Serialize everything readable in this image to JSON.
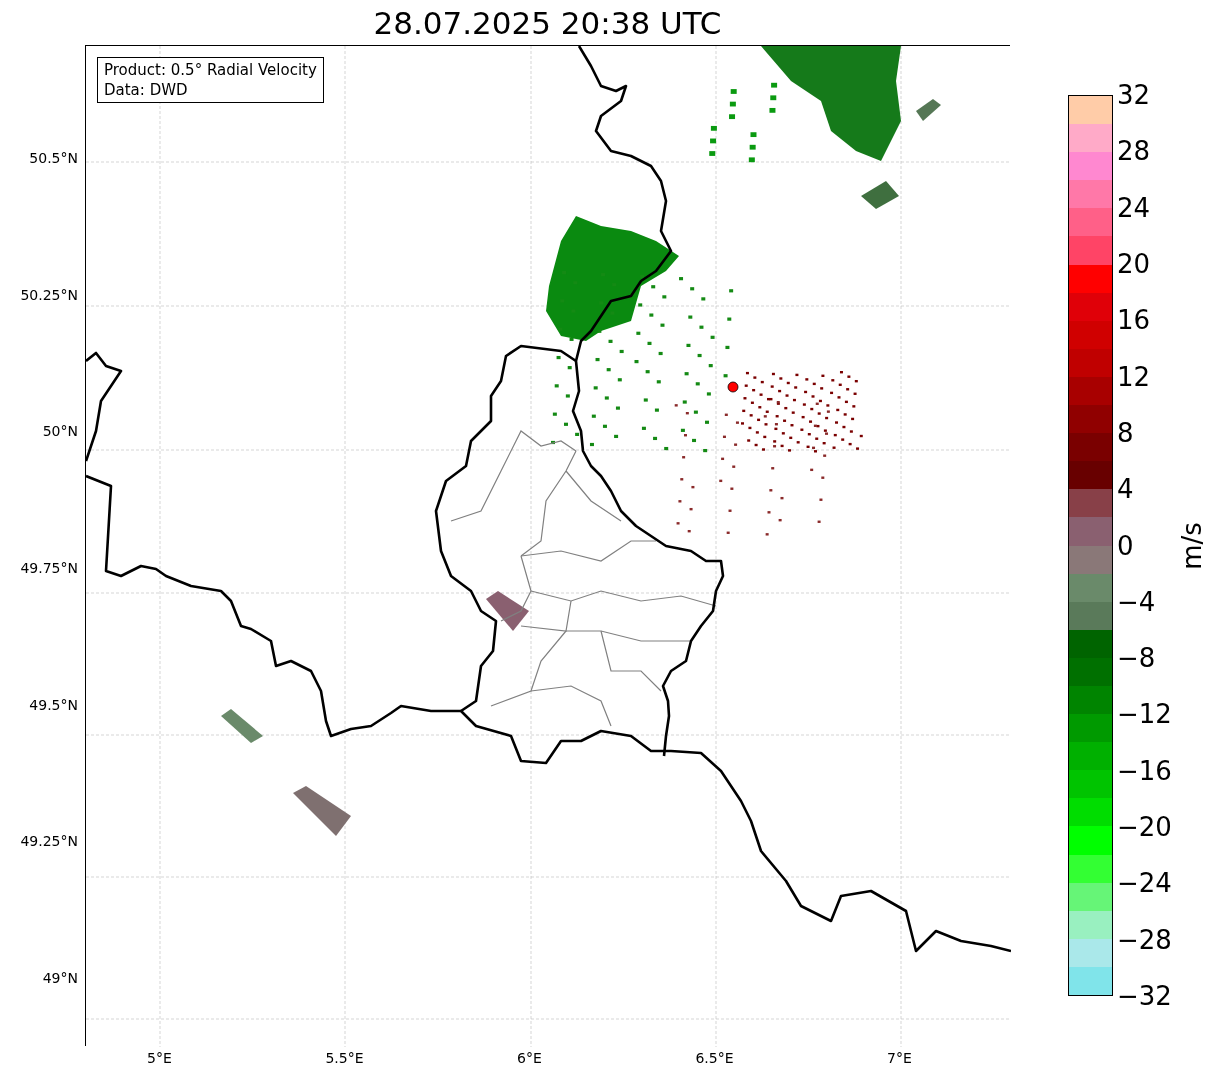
{
  "title": "28.07.2025 20:38 UTC",
  "legend": [
    "Product: 0.5° Radial Velocity",
    "Data: DWD"
  ],
  "lat_ticks": [
    "50.5°N",
    "50.25°N",
    "50°N",
    "49.75°N",
    "49.5°N",
    "49.25°N",
    "49°N"
  ],
  "lon_ticks": [
    "5°E",
    "5.5°E",
    "6°E",
    "6.5°E",
    "7°E"
  ],
  "colorbar": {
    "label": "m/s",
    "ticks": [
      "32",
      "28",
      "24",
      "20",
      "16",
      "12",
      "8",
      "4",
      "0",
      "−4",
      "−8",
      "−12",
      "−16",
      "−20",
      "−24",
      "−28",
      "−32"
    ],
    "segments": [
      {
        "color": "#ffcca8"
      },
      {
        "color": "#ffaac8"
      },
      {
        "color": "#ff88d0"
      },
      {
        "color": "#ff78a8"
      },
      {
        "color": "#ff6088"
      },
      {
        "color": "#ff4466"
      },
      {
        "color": "#ff0000"
      },
      {
        "color": "#e00008"
      },
      {
        "color": "#d00000"
      },
      {
        "color": "#c00000"
      },
      {
        "color": "#a80000"
      },
      {
        "color": "#900000"
      },
      {
        "color": "#7a0000"
      },
      {
        "color": "#680000"
      },
      {
        "color": "#884048"
      },
      {
        "color": "#8a6070"
      },
      {
        "color": "#8a7878"
      },
      {
        "color": "#6a8a6a"
      },
      {
        "color": "#5a7a5a"
      },
      {
        "color": "#006400"
      },
      {
        "color": "#007000"
      },
      {
        "color": "#008400"
      },
      {
        "color": "#009a00"
      },
      {
        "color": "#00b000"
      },
      {
        "color": "#00c400"
      },
      {
        "color": "#00dd00"
      },
      {
        "color": "#00ff00"
      },
      {
        "color": "#33ff33"
      },
      {
        "color": "#66f577"
      },
      {
        "color": "#99f0c0"
      },
      {
        "color": "#aae8ea"
      },
      {
        "color": "#80e4ea"
      }
    ]
  }
}
